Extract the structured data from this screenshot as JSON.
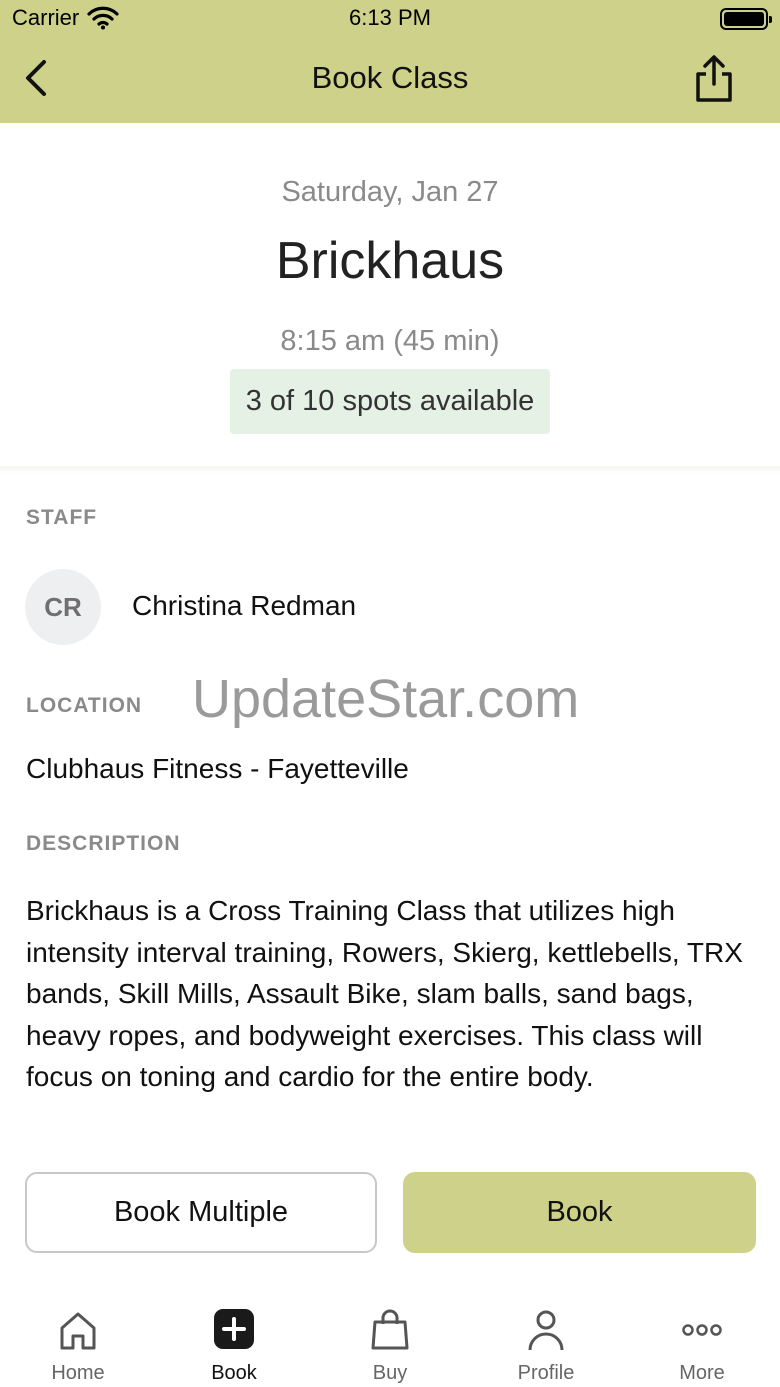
{
  "status_bar": {
    "carrier": "Carrier",
    "time": "6:13 PM"
  },
  "nav": {
    "title": "Book Class"
  },
  "header": {
    "date": "Saturday, Jan 27",
    "class_name": "Brickhaus",
    "time": "8:15 am (45 min)",
    "spots": "3 of 10 spots available"
  },
  "staff": {
    "label": "STAFF",
    "initials": "CR",
    "name": "Christina Redman"
  },
  "location": {
    "label": "LOCATION",
    "name": "Clubhaus Fitness - Fayetteville"
  },
  "watermark": "UpdateStar.com",
  "description": {
    "label": "DESCRIPTION",
    "text": "Brickhaus is a Cross Training Class that utilizes high intensity interval training, Rowers, Skierg, kettlebells, TRX bands, Skill Mills, Assault Bike, slam balls, sand bags, heavy ropes, and bodyweight exercises. This class will focus on toning and cardio for the entire body."
  },
  "actions": {
    "book_multiple": "Book Multiple",
    "book": "Book"
  },
  "tabs": [
    {
      "label": "Home",
      "icon": "home-icon"
    },
    {
      "label": "Book",
      "icon": "plus-square-icon",
      "active": true
    },
    {
      "label": "Buy",
      "icon": "shopping-bag-icon"
    },
    {
      "label": "Profile",
      "icon": "person-icon"
    },
    {
      "label": "More",
      "icon": "more-dots-icon"
    }
  ],
  "colors": {
    "accent": "#cdd18a",
    "spots_bg": "#e5f1e4",
    "muted_text": "#8a8a8a"
  }
}
